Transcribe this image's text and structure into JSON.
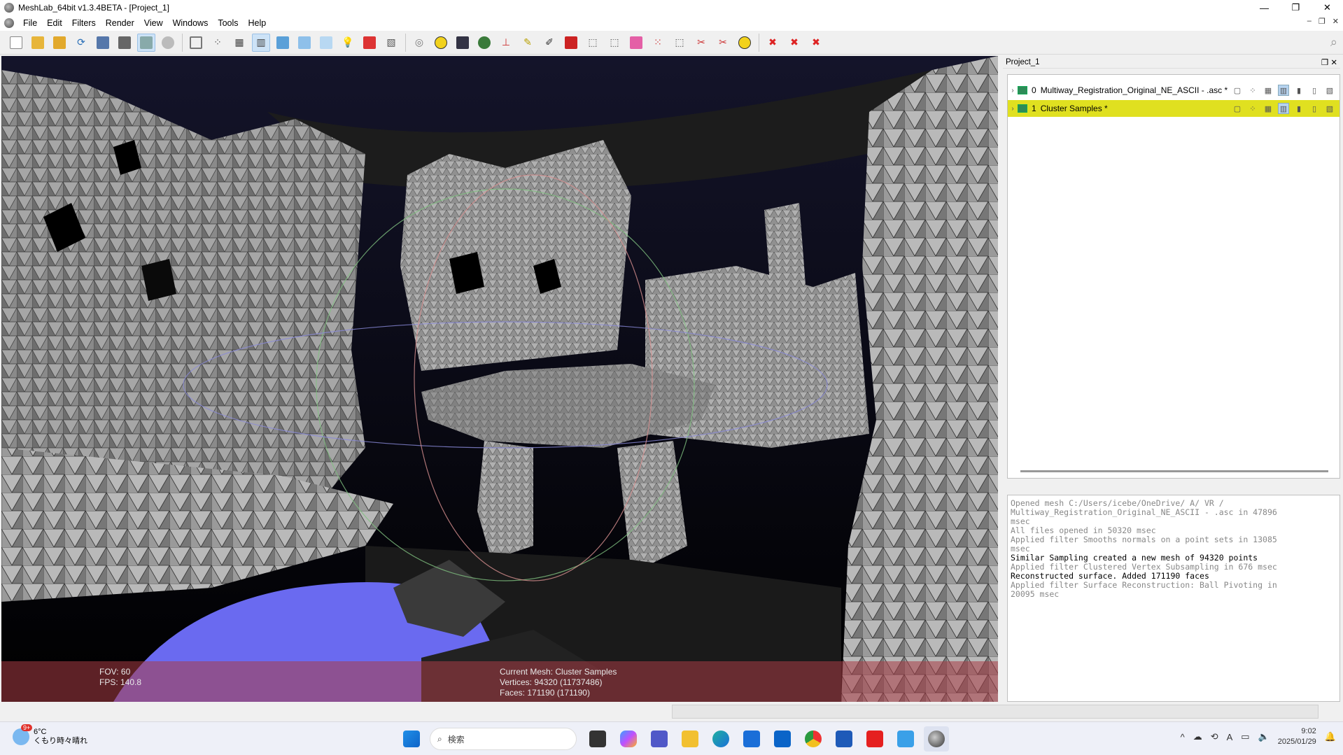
{
  "window": {
    "title": "MeshLab_64bit v1.3.4BETA - [Project_1]"
  },
  "menu": [
    "File",
    "Edit",
    "Filters",
    "Render",
    "View",
    "Windows",
    "Tools",
    "Help"
  ],
  "hud": {
    "fov": "FOV: 60",
    "fps": "FPS:   140.8",
    "current_mesh": "Current Mesh: Cluster Samples",
    "vertices": "Vertices: 94320 (11737486)",
    "faces": "Faces: 171190 (171190)"
  },
  "panel": {
    "title": "Project_1",
    "layers": [
      {
        "index": "0",
        "name": "Multiway_Registration_Original_NE_ASCII - .asc *",
        "selected": false
      },
      {
        "index": "1",
        "name": "Cluster Samples *",
        "selected": true
      }
    ]
  },
  "log": [
    {
      "text": "Opened mesh C:/Users/icebe/OneDrive/         A/   VR  /",
      "hi": false
    },
    {
      "text": "Multiway_Registration_Original_NE_ASCII - .asc in 47896",
      "hi": false
    },
    {
      "text": "msec",
      "hi": false
    },
    {
      "text": "All files opened in 50320 msec",
      "hi": false
    },
    {
      "text": "Applied filter Smooths normals on a point sets in 13085",
      "hi": false
    },
    {
      "text": "msec",
      "hi": false
    },
    {
      "text": "Similar Sampling created a new mesh of 94320 points",
      "hi": true
    },
    {
      "text": "Applied filter Clustered Vertex Subsampling in 676 msec",
      "hi": false
    },
    {
      "text": "Reconstructed surface. Added 171190 faces",
      "hi": true
    },
    {
      "text": "Applied filter Surface Reconstruction: Ball Pivoting in",
      "hi": false
    },
    {
      "text": "20095 msec",
      "hi": false
    }
  ],
  "taskbar": {
    "weather_temp": "6°C",
    "weather_desc": "くもり時々晴れ",
    "weather_badge": "9+",
    "search_placeholder": "検索",
    "time": "9:02",
    "date": "2025/01/29"
  },
  "colors": {
    "selected_layer": "#e0e020",
    "hud_band": "#aa3c46",
    "floor": "#6a6af0"
  }
}
